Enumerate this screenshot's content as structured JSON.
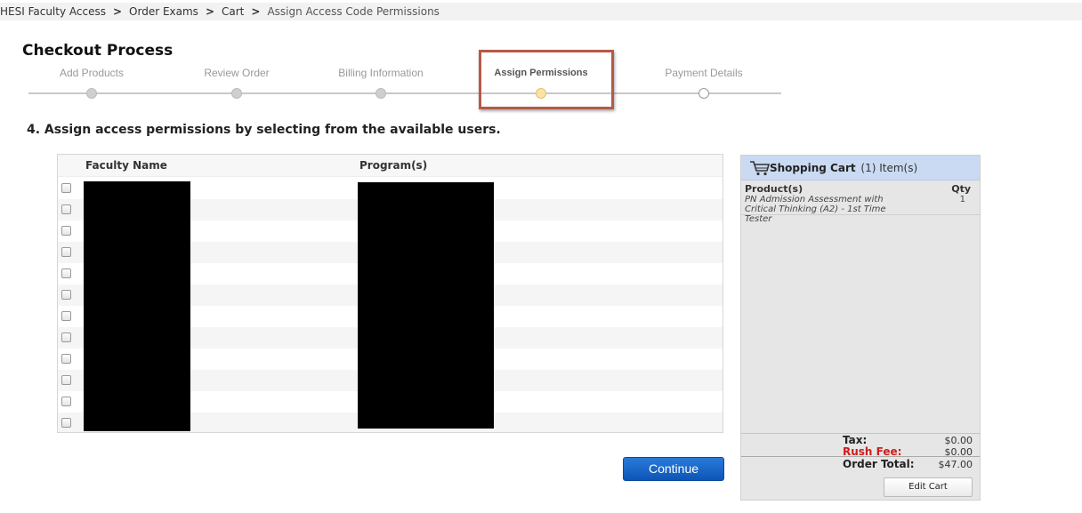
{
  "breadcrumb": {
    "items": [
      "HESI Faculty Access",
      "Order Exams",
      "Cart"
    ],
    "separator": ">",
    "current": "Assign Access Code Permissions"
  },
  "page_title": "Checkout Process",
  "stepper": {
    "steps": [
      {
        "label": "Add Products",
        "state": "complete"
      },
      {
        "label": "Review Order",
        "state": "complete"
      },
      {
        "label": "Billing Information",
        "state": "complete"
      },
      {
        "label": "Assign Permissions",
        "state": "active"
      },
      {
        "label": "Payment Details",
        "state": "future"
      }
    ],
    "active_color": "#fbe3a6",
    "highlight_color": "#b55a48"
  },
  "instruction": "4. Assign access permissions by selecting from the available users.",
  "user_table": {
    "headers": [
      "Faculty Name",
      "Program(s)"
    ],
    "row_count": 12,
    "rows_redacted": true
  },
  "cart": {
    "title": "Shopping Cart",
    "item_count_text": "(1) Item(s)",
    "col_product": "Product(s)",
    "col_qty": "Qty",
    "items": [
      {
        "name": "PN Admission Assessment with Critical Thinking (A2) - 1st Time Tester",
        "qty": "1"
      }
    ],
    "tax_label": "Tax:",
    "tax_value": "$0.00",
    "rush_label": "Rush Fee:",
    "rush_value": "$0.00",
    "total_label": "Order Total:",
    "total_value": "$47.00",
    "edit_label": "Edit Cart",
    "header_color": "#c9daf2",
    "rush_color": "#d01c1c",
    "icon": "shopping-cart-icon"
  },
  "continue_label": "Continue",
  "continue_color": "#1a6bd0"
}
